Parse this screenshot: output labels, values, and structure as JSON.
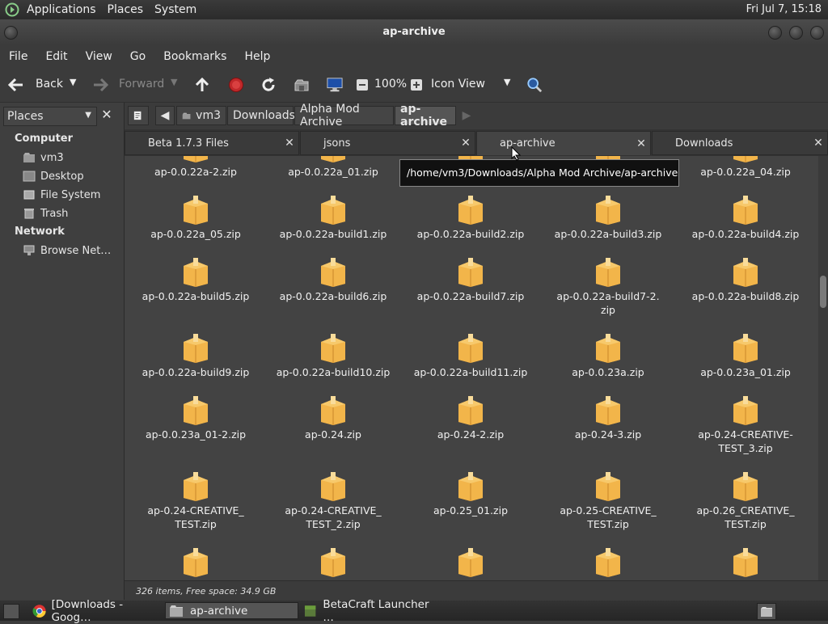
{
  "top_panel": {
    "menus": [
      "Applications",
      "Places",
      "System"
    ],
    "clock": "Fri Jul  7, 15:18"
  },
  "window": {
    "title": "ap-archive"
  },
  "menu_bar": [
    "File",
    "Edit",
    "View",
    "Go",
    "Bookmarks",
    "Help"
  ],
  "toolbar": {
    "back": "Back",
    "forward": "Forward",
    "zoom": "100%",
    "view_mode": "Icon View"
  },
  "sidebar": {
    "selector": "Places",
    "sections": [
      {
        "heading": "Computer",
        "items": [
          "vm3",
          "Desktop",
          "File System",
          "Trash"
        ]
      },
      {
        "heading": "Network",
        "items": [
          "Browse Net…"
        ]
      }
    ]
  },
  "breadcrumb": [
    "vm3",
    "Downloads",
    "Alpha Mod Archive",
    "ap-archive"
  ],
  "tabs": [
    {
      "label": "Beta 1.7.3 Files"
    },
    {
      "label": "jsons"
    },
    {
      "label": "ap-archive"
    },
    {
      "label": "Downloads"
    }
  ],
  "tooltip": "/home/vm3/Downloads/Alpha Mod Archive/ap-archive",
  "files": [
    "ap-0.0.22a-2.zip",
    "ap-0.0.22a_01.zip",
    "",
    "",
    "ap-0.0.22a_04.zip",
    "ap-0.0.22a_05.zip",
    "ap-0.0.22a-build1.zip",
    "ap-0.0.22a-build2.zip",
    "ap-0.0.22a-build3.zip",
    "ap-0.0.22a-build4.zip",
    "ap-0.0.22a-build5.zip",
    "ap-0.0.22a-build6.zip",
    "ap-0.0.22a-build7.zip",
    "ap-0.0.22a-build7-2.\nzip",
    "ap-0.0.22a-build8.zip",
    "ap-0.0.22a-build9.zip",
    "ap-0.0.22a-build10.zip",
    "ap-0.0.22a-build11.zip",
    "ap-0.0.23a.zip",
    "ap-0.0.23a_01.zip",
    "ap-0.0.23a_01-2.zip",
    "ap-0.24.zip",
    "ap-0.24-2.zip",
    "ap-0.24-3.zip",
    "ap-0.24-CREATIVE-\nTEST_3.zip",
    "ap-0.24-CREATIVE_\nTEST.zip",
    "ap-0.24-CREATIVE_\nTEST_2.zip",
    "ap-0.25_01.zip",
    "ap-0.25-CREATIVE_\nTEST.zip",
    "ap-0.26_CREATIVE_\nTEST.zip",
    "",
    "",
    "",
    "",
    ""
  ],
  "status": "326 items, Free space: 34.9 GB",
  "taskbar": [
    "[Downloads - Goog…",
    "ap-archive",
    "BetaCraft Launcher …"
  ]
}
